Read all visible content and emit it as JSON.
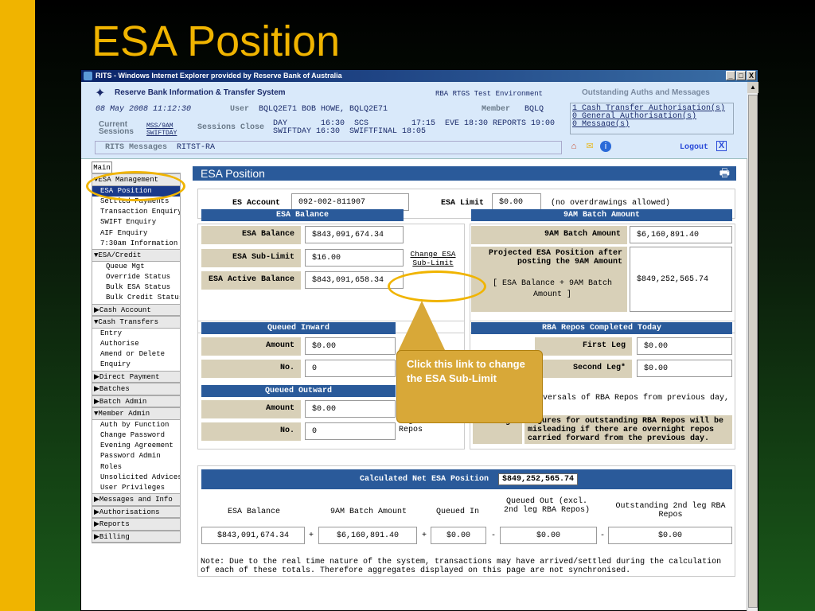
{
  "slide_title": "ESA Position",
  "window": {
    "title": "RITS - Windows Internet Explorer provided by Reserve Bank of Australia",
    "min": "_",
    "max": "□",
    "close": "X"
  },
  "header": {
    "system_name": "Reserve Bank Information & Transfer System",
    "environment": "RBA RTGS Test Environment",
    "outstanding_title": "Outstanding Auths and Messages",
    "datetime": "08 May 2008 11:12:30",
    "user_label": "User",
    "user_value": "BQLQ2E71 BOB HOWE, BQLQ2E71",
    "member_label": "Member",
    "member_value": "BQLQ",
    "current_label1": "Current",
    "current_label2": "Sessions",
    "session1": "MSS/9AM",
    "session2": "SWIFTDAY",
    "sessions_close_label": "Sessions Close",
    "times_line1": "DAY       16:30  SCS         17:15  EVE 18:30 REPORTS 19:00",
    "times_line2": "SWIFTDAY 16:30  SWIFTFINAL 18:05",
    "auth1": "1 Cash Transfer Authorisation(s)",
    "auth2": "0 General Authorisation(s)",
    "auth3": "0 Message(s)",
    "messages_label": "RITS Messages",
    "messages_value": "RITST-RA",
    "logout": "Logout",
    "logout_x": "X"
  },
  "sidebar": {
    "tab": "Main",
    "items": [
      {
        "label": "▼ESA Management",
        "type": "grp"
      },
      {
        "label": "ESA Position",
        "type": "sel"
      },
      {
        "label": "Settled Payments",
        "type": "it"
      },
      {
        "label": "Transaction Enquiry",
        "type": "it"
      },
      {
        "label": "SWIFT Enquiry",
        "type": "it"
      },
      {
        "label": "AIF Enquiry",
        "type": "it"
      },
      {
        "label": "7:30am Information",
        "type": "it"
      },
      {
        "label": "▼ESA/Credit",
        "type": "grp"
      },
      {
        "label": "Queue Mgt",
        "type": "sub"
      },
      {
        "label": "Override Status",
        "type": "sub"
      },
      {
        "label": "Bulk ESA Status",
        "type": "sub"
      },
      {
        "label": "Bulk Credit Status",
        "type": "sub"
      },
      {
        "label": "▶Cash Account",
        "type": "grp"
      },
      {
        "label": "▼Cash Transfers",
        "type": "grp"
      },
      {
        "label": "Entry",
        "type": "it2"
      },
      {
        "label": "Authorise",
        "type": "it2"
      },
      {
        "label": "Amend or Delete",
        "type": "it2"
      },
      {
        "label": "Enquiry",
        "type": "it2"
      },
      {
        "label": "▶Direct Payment",
        "type": "grp"
      },
      {
        "label": "▶Batches",
        "type": "grp"
      },
      {
        "label": "▶Batch Admin",
        "type": "grp"
      },
      {
        "label": "▼Member Admin",
        "type": "grp"
      },
      {
        "label": "Auth by Function",
        "type": "it2"
      },
      {
        "label": "Change Password",
        "type": "it2"
      },
      {
        "label": "Evening Agreement",
        "type": "it2"
      },
      {
        "label": "Password Admin",
        "type": "it2"
      },
      {
        "label": "Roles",
        "type": "it2"
      },
      {
        "label": "Unsolicited Advices",
        "type": "it2"
      },
      {
        "label": "User Privileges",
        "type": "it2"
      },
      {
        "label": "▶Messages and Info",
        "type": "grp"
      },
      {
        "label": "▶Authorisations",
        "type": "grp"
      },
      {
        "label": "▶Reports",
        "type": "grp"
      },
      {
        "label": "▶Billing",
        "type": "grp"
      }
    ]
  },
  "page": {
    "title": "ESA Position",
    "es_account_label": "ES Account",
    "es_account_value": "092-002-811907",
    "esa_limit_label": "ESA Limit",
    "esa_limit_value": "$0.00",
    "esa_limit_note": "(no overdrawings allowed)",
    "esa_balance_hdr": "ESA Balance",
    "esa_balance_label": "ESA Balance",
    "esa_balance_value": "$843,091,674.34",
    "esa_sublimit_label": "ESA Sub-Limit",
    "esa_sublimit_value": "$16.00",
    "change_link": "Change ESA\nSub-Limit",
    "esa_active_label": "ESA Active Balance",
    "esa_active_value": "$843,091,658.34",
    "batch_hdr": "9AM Batch Amount",
    "batch_label": "9AM Batch Amount",
    "batch_value": "$6,160,891.40",
    "projected_label": "Projected ESA Position after posting the 9AM Amount",
    "projected_formula": "[ ESA Balance + 9AM Batch Amount ]",
    "projected_value": "$849,252,565.74",
    "queued_in_hdr": "Queued Inward",
    "amount_label": "Amount",
    "qi_amount": "$0.00",
    "no_label": "No.",
    "qi_no": "0",
    "queued_out_hdr": "Queued Outward",
    "qo_amount": "$0.00",
    "qo_no": "0",
    "qo_note": "Including queued 2nd leg RBA Repos",
    "repos_hdr": "RBA Repos Completed Today",
    "first_leg_label": "First Leg",
    "first_leg_value": "$0.00",
    "second_leg_label": "Second Leg*",
    "second_leg_value": "$0.00",
    "repos_note": "(* Includes reversals of RBA Repos from previous day, if any)",
    "warning_label": "Warning:",
    "warning_text": "Figures for outstanding RBA Repos will be misleading if there are overnight repos carried forward from the previous day.",
    "calc_label": "Calculated Net ESA Position",
    "calc_value": "$849,252,565.74",
    "col1": "ESA Balance",
    "col2": "9AM Batch Amount",
    "col3": "Queued In",
    "col4": "Queued Out (excl. 2nd leg RBA Repos)",
    "col5": "Outstanding 2nd leg RBA Repos",
    "v1": "$843,091,674.34",
    "v2": "$6,160,891.40",
    "v3": "$0.00",
    "v4": "$0.00",
    "v5": "$0.00",
    "op1": "+",
    "op2": "+",
    "op3": "-",
    "op4": "-",
    "note": "Note: Due to the real time nature of the system, transactions may have arrived/settled during the calculation of each of these totals. Therefore aggregates displayed on this page are not synchronised."
  },
  "callout": "Click this link to change the ESA Sub-Limit"
}
